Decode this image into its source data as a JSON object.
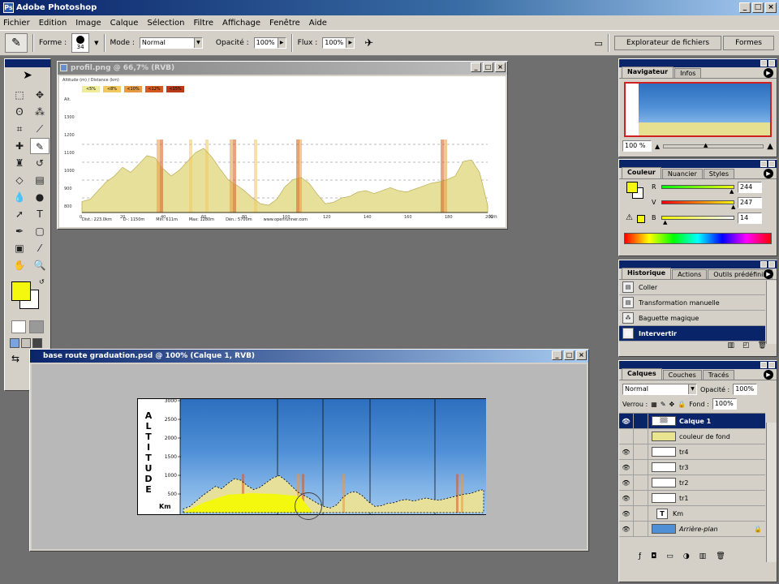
{
  "app": {
    "title": "Adobe Photoshop"
  },
  "menu": [
    "Fichier",
    "Edition",
    "Image",
    "Calque",
    "Sélection",
    "Filtre",
    "Affichage",
    "Fenêtre",
    "Aide"
  ],
  "options": {
    "forme_label": "Forme :",
    "brush_size": "34",
    "mode_label": "Mode :",
    "mode_value": "Normal",
    "opacite_label": "Opacité :",
    "opacite_value": "100%",
    "flux_label": "Flux :",
    "flux_value": "100%",
    "tab_explorer": "Explorateur de fichiers",
    "tab_formes": "Formes"
  },
  "doc1": {
    "title": "profil.png @ 66,7% (RVB)",
    "top_label": "Altitude (m) / Distance (km)",
    "legend": [
      "<5%",
      "<8%",
      "<10%",
      "<12%",
      "<15%"
    ],
    "legend_colors": [
      "#f0ec9a",
      "#f2c860",
      "#e89a40",
      "#d45a20",
      "#b83a1a"
    ],
    "y_ticks": [
      "Alt.",
      "1300",
      "1200",
      "1100",
      "1000",
      "900",
      "800"
    ],
    "x_ticks": [
      "0",
      "20",
      "40",
      "60",
      "80",
      "100",
      "120",
      "140",
      "160",
      "180",
      "200"
    ],
    "x_unit": "Km",
    "footer": [
      "Dist.: 223.0km",
      "D-: 1150m",
      "Min: 611m",
      "Max: 1280m",
      "Dén.: 5700m",
      "www.openrunner.com"
    ]
  },
  "doc2": {
    "title": "base route graduation.psd @ 100% (Calque 1, RVB)",
    "altitude_label": "ALTITUDE",
    "unit": "Km",
    "y_ticks": [
      "3000",
      "2500",
      "2000",
      "1500",
      "1000",
      "500"
    ]
  },
  "navigator": {
    "tabs": [
      "Navigateur",
      "Infos"
    ],
    "zoom": "100 %"
  },
  "color": {
    "tabs": [
      "Couleur",
      "Nuancier",
      "Styles"
    ],
    "r_label": "R",
    "r_value": "244",
    "v_label": "V",
    "v_value": "247",
    "b_label": "B",
    "b_value": "14",
    "fg_color": "#f4f70e"
  },
  "history": {
    "tabs": [
      "Historique",
      "Actions",
      "Outils prédéfinis"
    ],
    "items": [
      "Coller",
      "Transformation manuelle",
      "Baguette magique",
      "Intervertir"
    ],
    "selected_index": 3
  },
  "layers": {
    "tabs": [
      "Calques",
      "Couches",
      "Tracés"
    ],
    "blend": "Normal",
    "opacite_label": "Opacité :",
    "opacite_value": "100%",
    "verrou_label": "Verrou :",
    "fond_label": "Fond :",
    "fond_value": "100%",
    "items": [
      "Calque 1",
      "couleur de fond",
      "tr4",
      "tr3",
      "tr2",
      "tr1",
      "Km",
      "Arrière-plan"
    ],
    "selected_index": 0
  }
}
